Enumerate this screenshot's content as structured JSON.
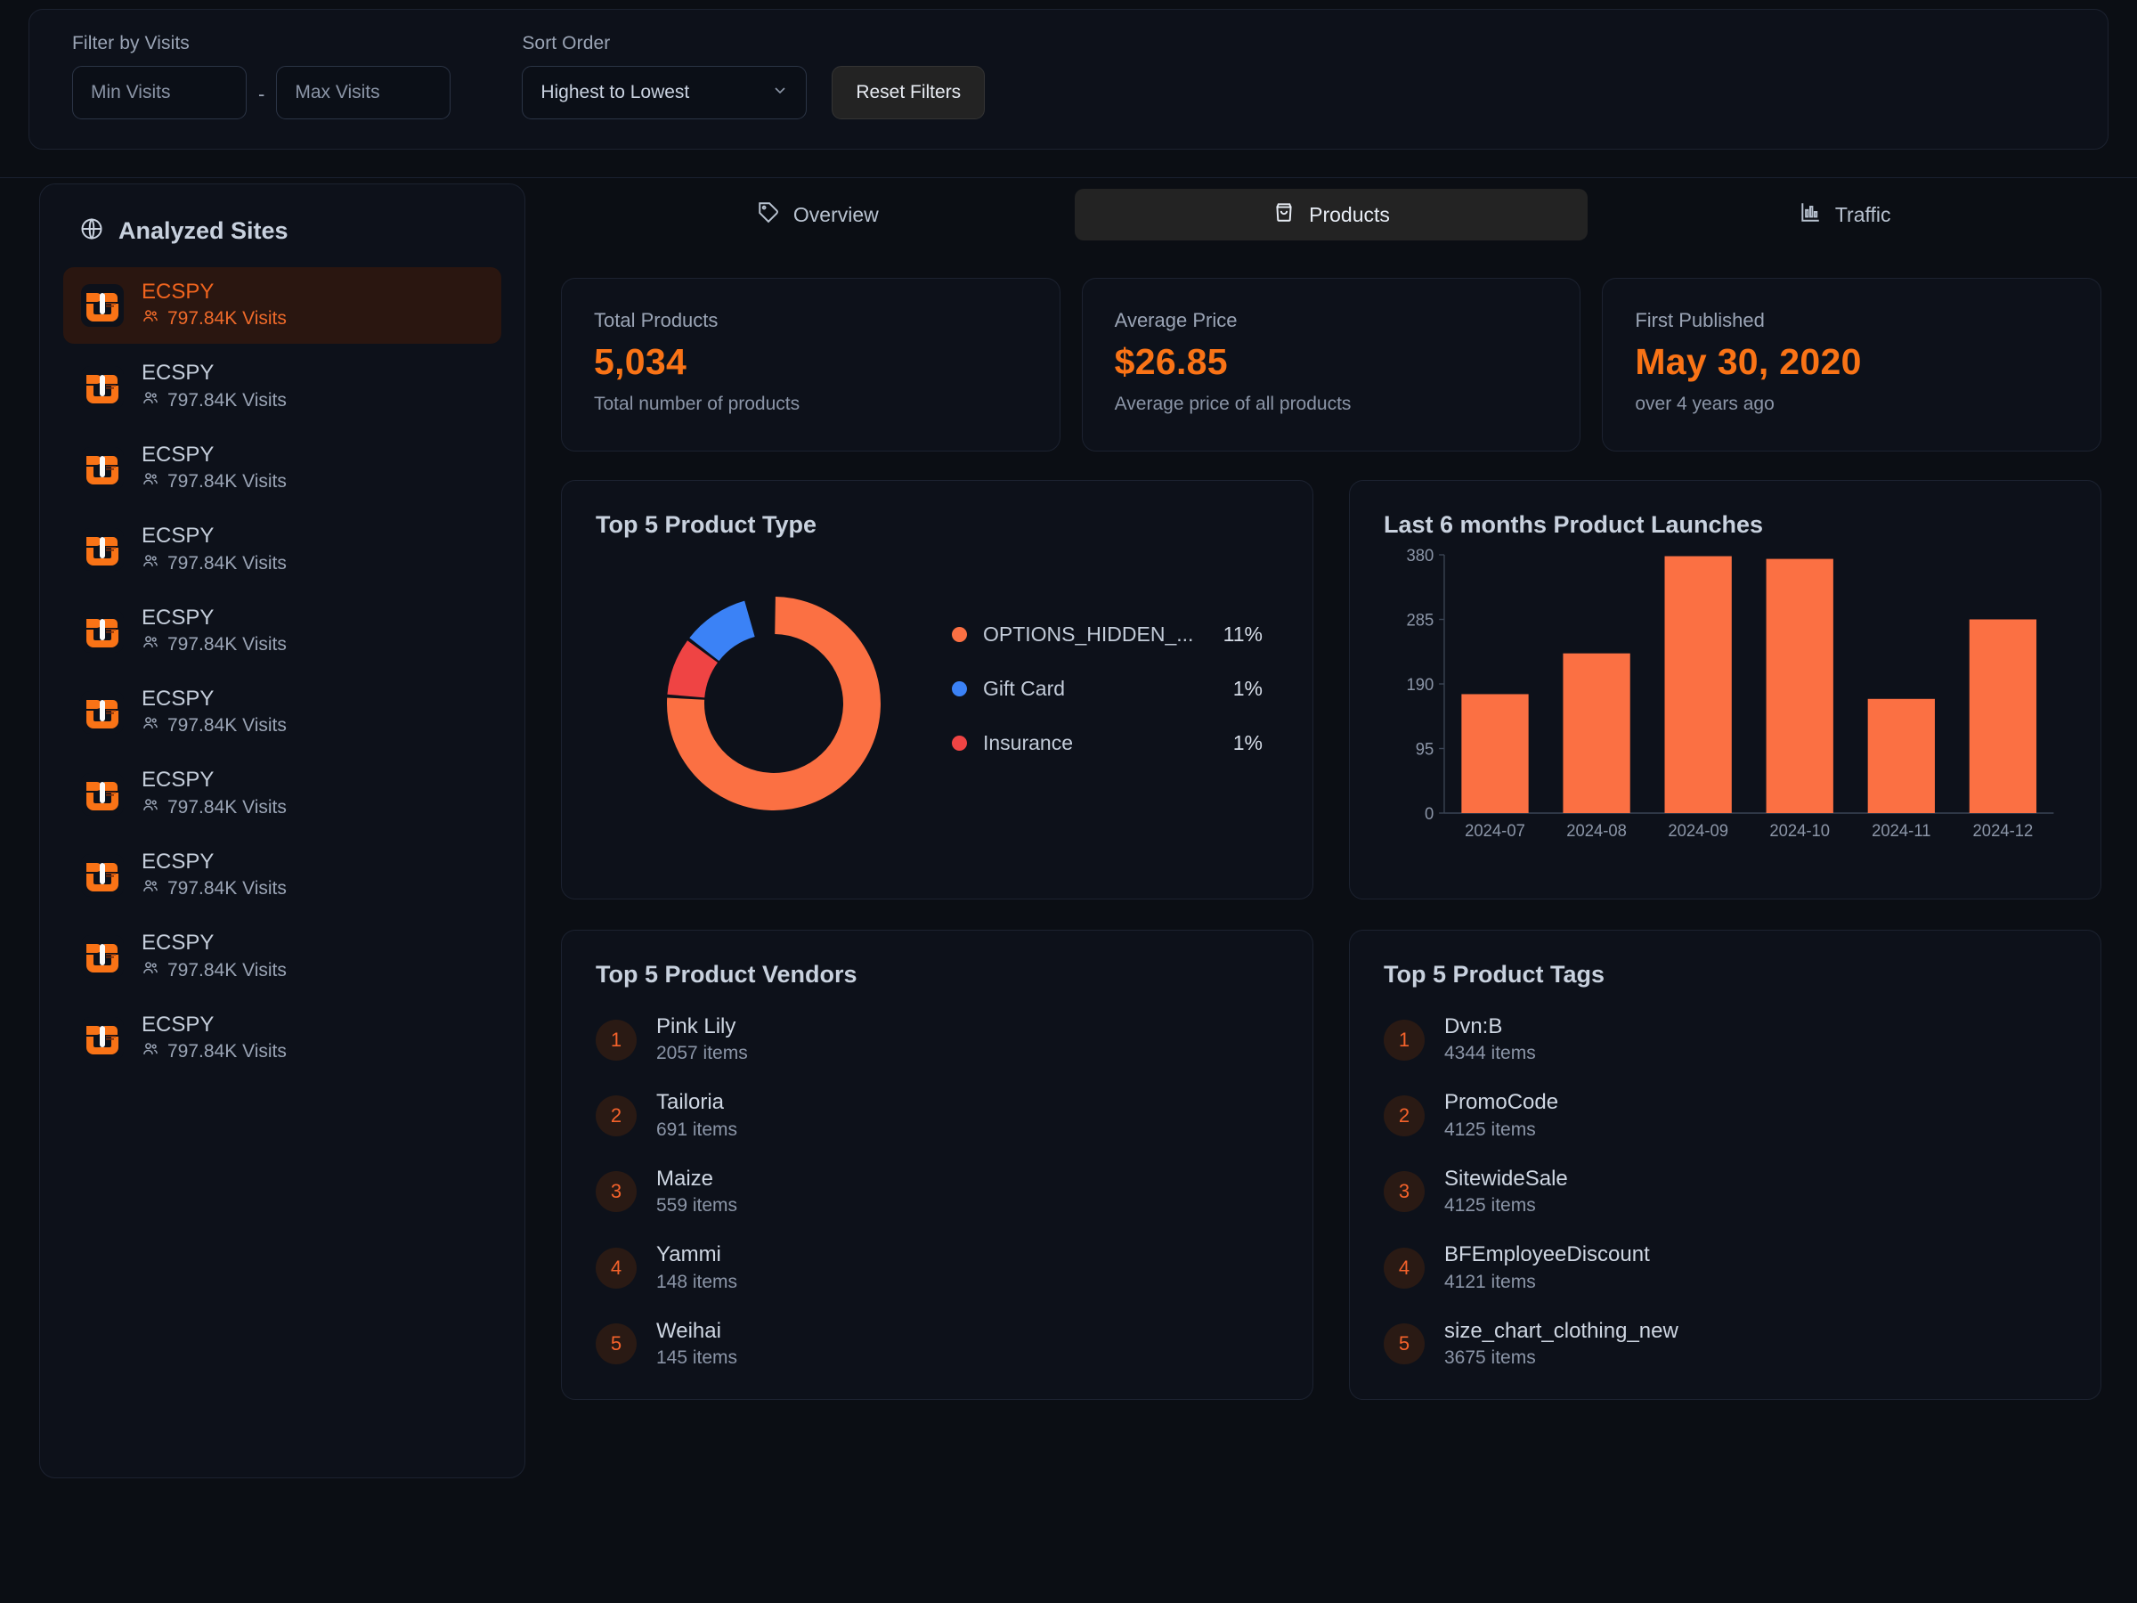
{
  "filters": {
    "visits_label": "Filter by Visits",
    "min_placeholder": "Min Visits",
    "max_placeholder": "Max Visits",
    "separator": "-",
    "sort_label": "Sort Order",
    "sort_value": "Highest to Lowest",
    "reset_label": "Reset Filters"
  },
  "sidebar": {
    "title": "Analyzed Sites",
    "icon": "globe-icon",
    "items": [
      {
        "name": "ECSPY",
        "visits": "797.84K Visits",
        "active": true
      },
      {
        "name": "ECSPY",
        "visits": "797.84K Visits",
        "active": false
      },
      {
        "name": "ECSPY",
        "visits": "797.84K Visits",
        "active": false
      },
      {
        "name": "ECSPY",
        "visits": "797.84K Visits",
        "active": false
      },
      {
        "name": "ECSPY",
        "visits": "797.84K Visits",
        "active": false
      },
      {
        "name": "ECSPY",
        "visits": "797.84K Visits",
        "active": false
      },
      {
        "name": "ECSPY",
        "visits": "797.84K Visits",
        "active": false
      },
      {
        "name": "ECSPY",
        "visits": "797.84K Visits",
        "active": false
      },
      {
        "name": "ECSPY",
        "visits": "797.84K Visits",
        "active": false
      },
      {
        "name": "ECSPY",
        "visits": "797.84K Visits",
        "active": false
      }
    ]
  },
  "tabs": [
    {
      "label": "Overview",
      "icon": "tag-icon",
      "active": false
    },
    {
      "label": "Products",
      "icon": "shopping-bag-icon",
      "active": true
    },
    {
      "label": "Traffic",
      "icon": "bar-chart-icon",
      "active": false
    }
  ],
  "stats": [
    {
      "label": "Total Products",
      "value": "5,034",
      "sub": "Total number of products"
    },
    {
      "label": "Average Price",
      "value": "$26.85",
      "sub": "Average price of all products"
    },
    {
      "label": "First Published",
      "value": "May 30, 2020",
      "sub": "over 4 years ago"
    }
  ],
  "panels": {
    "product_type_title": "Top 5 Product Type",
    "launches_title": "Last 6 months Product Launches",
    "vendors_title": "Top 5 Product Vendors",
    "tags_title": "Top 5 Product Tags"
  },
  "vendors": [
    {
      "rank": "1",
      "name": "Pink Lily",
      "items": "2057 items"
    },
    {
      "rank": "2",
      "name": "Tailoria",
      "items": "691 items"
    },
    {
      "rank": "3",
      "name": "Maize",
      "items": "559 items"
    },
    {
      "rank": "4",
      "name": "Yammi",
      "items": "148 items"
    },
    {
      "rank": "5",
      "name": "Weihai",
      "items": "145 items"
    }
  ],
  "tags": [
    {
      "rank": "1",
      "name": "Dvn:B",
      "items": "4344 items"
    },
    {
      "rank": "2",
      "name": "PromoCode",
      "items": "4125 items"
    },
    {
      "rank": "3",
      "name": "SitewideSale",
      "items": "4125 items"
    },
    {
      "rank": "4",
      "name": "BFEmployeeDiscount",
      "items": "4121 items"
    },
    {
      "rank": "5",
      "name": "size_chart_clothing_new",
      "items": "3675 items"
    }
  ],
  "colors": {
    "accent": "#f97316",
    "orange": "#fb7043",
    "blue": "#3b82f6",
    "red": "#ef4444",
    "panel_bg": "#0d111a",
    "page_bg": "#0b0e14"
  },
  "chart_data": [
    {
      "type": "pie",
      "title": "Top 5 Product Type",
      "legend_position": "right",
      "labels": [
        "OPTIONS_HIDDEN_...",
        "Gift Card",
        "Insurance"
      ],
      "percent_labels": [
        "11%",
        "1%",
        "1%"
      ],
      "slice_fractions": [
        0.7611,
        0.0917,
        0.1056
      ],
      "colors": [
        "#fb7043",
        "#ef4444",
        "#3b82f6"
      ],
      "legend_colors": [
        "#fb7043",
        "#3b82f6",
        "#ef4444"
      ]
    },
    {
      "type": "bar",
      "title": "Last 6 months Product Launches",
      "categories": [
        "2024-07",
        "2024-08",
        "2024-09",
        "2024-10",
        "2024-11",
        "2024-12"
      ],
      "values": [
        175,
        235,
        378,
        374,
        168,
        285
      ],
      "yticks": [
        0,
        95,
        190,
        285,
        380
      ],
      "ylim": [
        0,
        380
      ],
      "xlabel": "",
      "ylabel": "",
      "grid": false,
      "bar_color": "#fb7043"
    }
  ]
}
